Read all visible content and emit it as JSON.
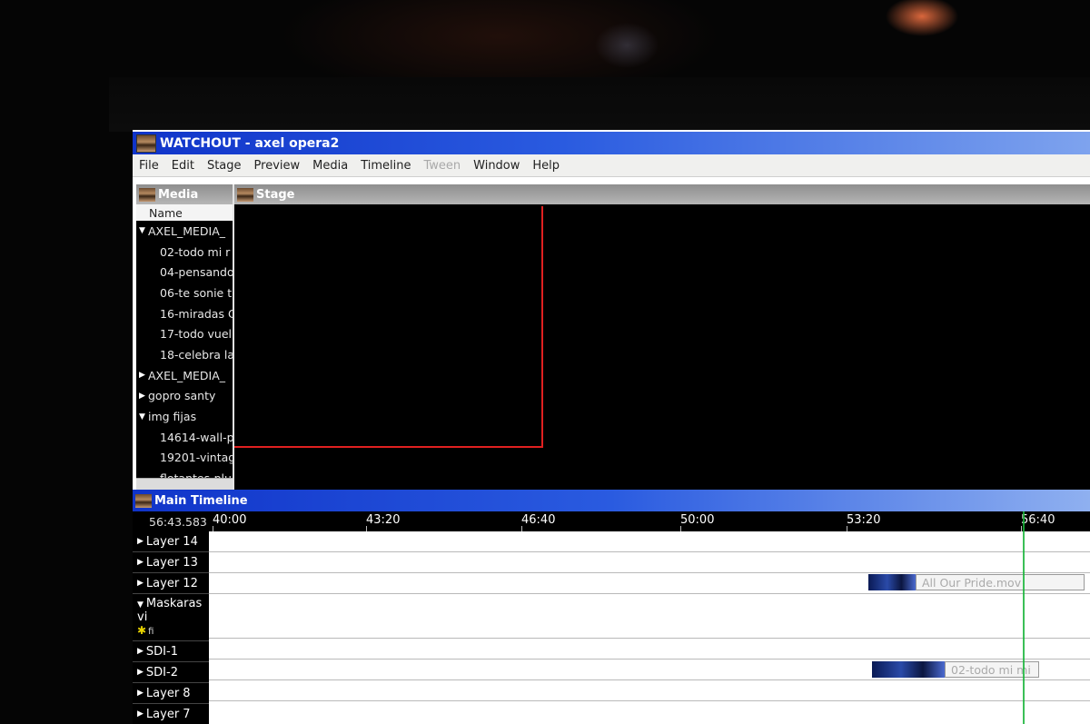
{
  "window": {
    "title": "WATCHOUT - axel opera2"
  },
  "menu": [
    "File",
    "Edit",
    "Stage",
    "Preview",
    "Media",
    "Timeline",
    "Tween",
    "Window",
    "Help"
  ],
  "media_panel": {
    "title": "Media",
    "column": "Name",
    "items": [
      {
        "label": "AXEL_MEDIA_",
        "folder": true,
        "expanded": true
      },
      {
        "label": "02-todo mi r",
        "folder": false
      },
      {
        "label": "04-pensando",
        "folder": false
      },
      {
        "label": "06-te sonie t",
        "folder": false
      },
      {
        "label": "16-miradas C",
        "folder": false
      },
      {
        "label": "17-todo vuel",
        "folder": false
      },
      {
        "label": "18-celebra la",
        "folder": false
      },
      {
        "label": "AXEL_MEDIA_",
        "folder": true,
        "expanded": false
      },
      {
        "label": "gopro santy",
        "folder": true,
        "expanded": false
      },
      {
        "label": "img fijas",
        "folder": true,
        "expanded": true
      },
      {
        "label": "14614-wall-p",
        "folder": false
      },
      {
        "label": "19201-vintag",
        "folder": false
      },
      {
        "label": "flotantes-plu",
        "folder": false
      }
    ]
  },
  "stage_panel": {
    "title": "Stage"
  },
  "timeline": {
    "title": "Main Timeline",
    "current_time": "56:43.583",
    "ticks": [
      "40:00",
      "43:20",
      "46:40",
      "50:00",
      "53:20",
      "56:40"
    ],
    "layers": [
      {
        "label": "Layer 14"
      },
      {
        "label": "Layer 13"
      },
      {
        "label": "Layer 12",
        "clip": "All Our Pride.mov"
      },
      {
        "label": "Maskaras vi",
        "sub": "fi"
      },
      {
        "label": "SDI-1"
      },
      {
        "label": "SDI-2",
        "clip": "02-todo mi mi"
      },
      {
        "label": "Layer 8"
      },
      {
        "label": "Layer 7"
      }
    ]
  },
  "colors": {
    "titlebar": "#1034c9",
    "stage_outline": "#e02020",
    "playhead": "#19b53a"
  }
}
